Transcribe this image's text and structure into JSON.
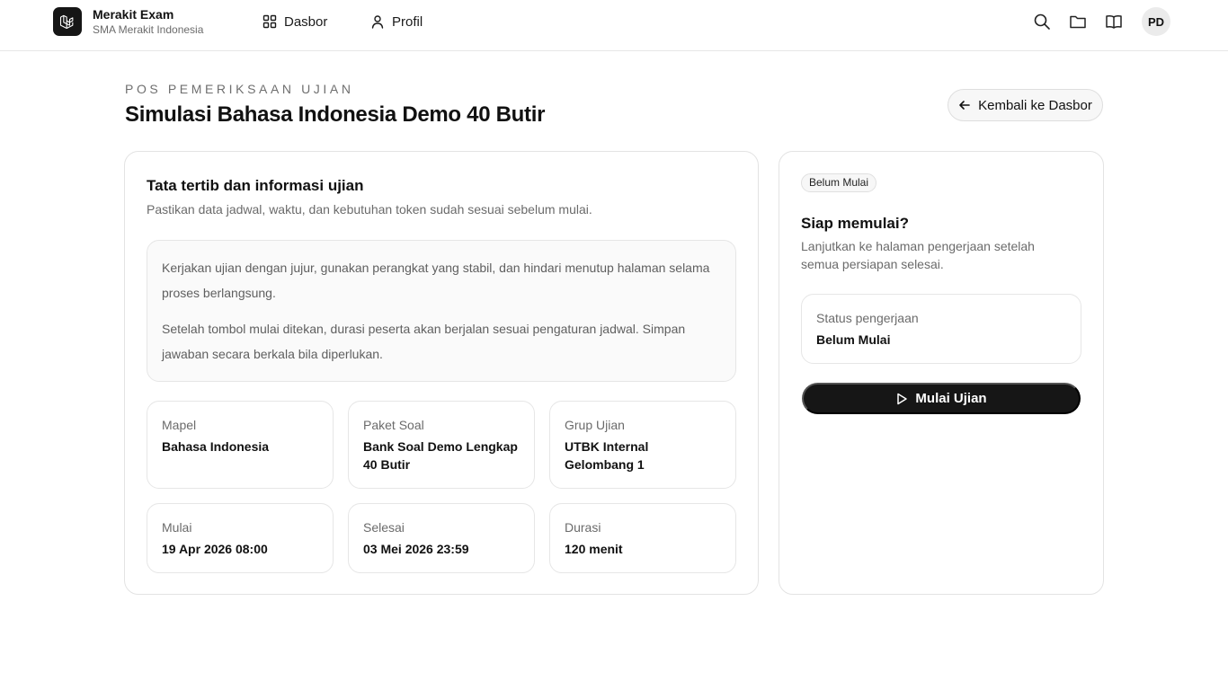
{
  "brand": {
    "name": "Merakit Exam",
    "school": "SMA Merakit Indonesia",
    "logo_icon": "laravel-logo-icon"
  },
  "nav": [
    {
      "label": "Dasbor",
      "icon": "grid-icon"
    },
    {
      "label": "Profil",
      "icon": "user-icon"
    }
  ],
  "toolbar": {
    "icons": [
      "search-icon",
      "folder-icon",
      "book-open-icon"
    ],
    "avatar_initials": "PD"
  },
  "page": {
    "eyebrow": "POS PEMERIKSAAN UJIAN",
    "title": "Simulasi Bahasa Indonesia Demo 40 Butir",
    "back_label": "Kembali ke Dasbor"
  },
  "rules_card": {
    "title": "Tata tertib dan informasi ujian",
    "subtitle": "Pastikan data jadwal, waktu, dan kebutuhan token sudah sesuai sebelum mulai.",
    "paragraphs": [
      "Kerjakan ujian dengan jujur, gunakan perangkat yang stabil, dan hindari menutup halaman selama proses berlangsung.",
      "Setelah tombol mulai ditekan, durasi peserta akan berjalan sesuai pengaturan jadwal. Simpan jawaban secara berkala bila diperlukan."
    ],
    "info": [
      {
        "label": "Mapel",
        "value": "Bahasa Indonesia"
      },
      {
        "label": "Paket Soal",
        "value": "Bank Soal Demo Lengkap 40 Butir"
      },
      {
        "label": "Grup Ujian",
        "value": "UTBK Internal Gelombang 1"
      },
      {
        "label": "Mulai",
        "value": "19 Apr 2026 08:00"
      },
      {
        "label": "Selesai",
        "value": "03 Mei 2026 23:59"
      },
      {
        "label": "Durasi",
        "value": "120 menit"
      }
    ]
  },
  "start_card": {
    "badge": "Belum Mulai",
    "title": "Siap memulai?",
    "subtitle": "Lanjutkan ke halaman pengerjaan setelah semua persiapan selesai.",
    "status_label": "Status pengerjaan",
    "status_value": "Belum Mulai",
    "start_label": "Mulai Ujian"
  },
  "colors": {
    "primary": "#161616",
    "muted_text": "#6b6b6b",
    "border": "#e3e3e3",
    "surface": "#fafafa"
  }
}
